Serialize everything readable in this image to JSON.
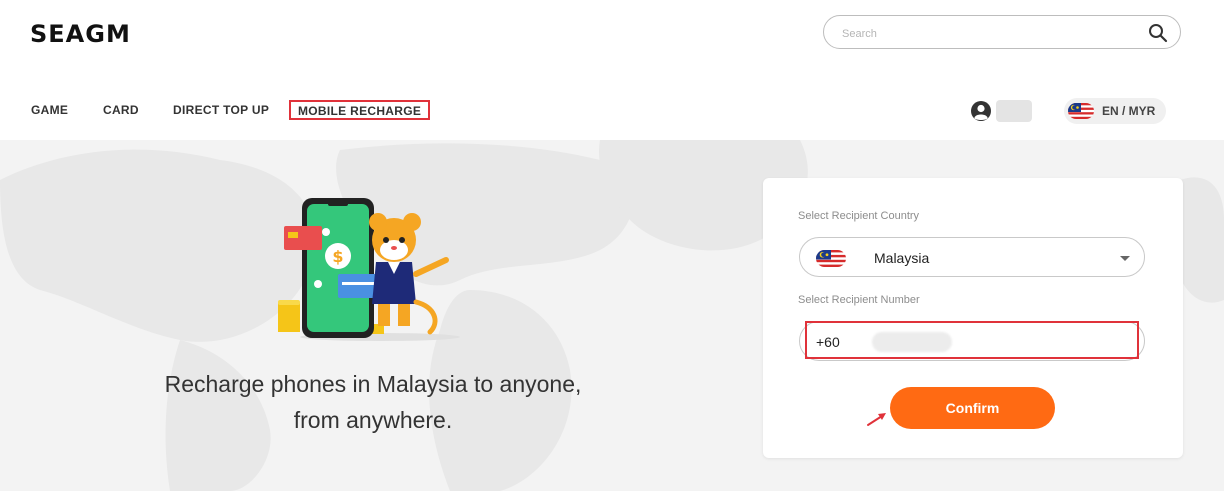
{
  "brand": {
    "logo_text": "SEAGM"
  },
  "search": {
    "placeholder": "Search",
    "icon": "search-icon"
  },
  "nav": {
    "items": [
      {
        "label": "GAME"
      },
      {
        "label": "CARD"
      },
      {
        "label": "DIRECT TOP UP"
      },
      {
        "label": "MOBILE RECHARGE",
        "highlighted": true
      }
    ]
  },
  "account": {
    "icon": "user-icon",
    "language_currency": "EN / MYR",
    "flag": "malaysia-flag-icon"
  },
  "hero": {
    "tagline_line1": "Recharge phones in Malaysia to anyone,",
    "tagline_line2": "from anywhere."
  },
  "form": {
    "country_label": "Select Recipient Country",
    "country_value": "Malaysia",
    "country_flag": "malaysia-flag-icon",
    "number_label": "Select Recipient Number",
    "number_prefix": "+60",
    "confirm_label": "Confirm"
  },
  "colors": {
    "accent": "#ff6a13",
    "highlight_box": "#e0323a",
    "hero_bg": "#f3f3f3"
  }
}
